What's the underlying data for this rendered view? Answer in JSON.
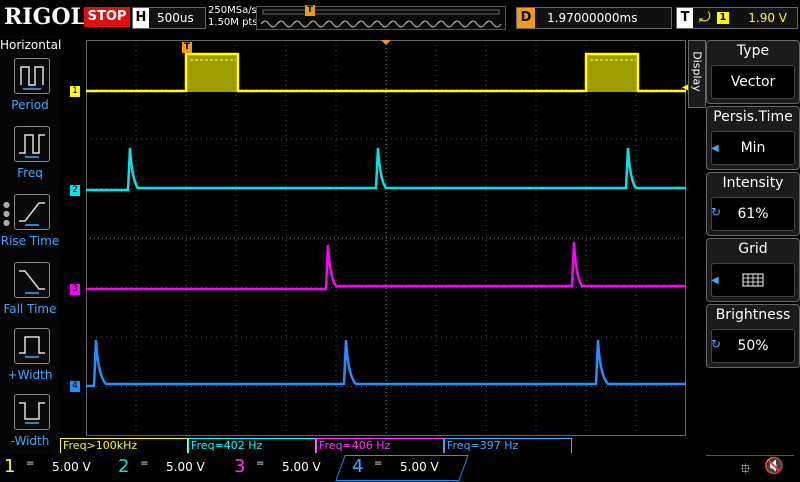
{
  "header": {
    "logo": "RIGOL",
    "run_state": "STOP",
    "timebase_label": "H",
    "timebase_value": "500us",
    "sample_rate": "250MSa/s",
    "memory_depth": "1.50M pts",
    "trigger_marker": "T",
    "delay_label": "D",
    "delay_value": "1.97000000ms",
    "trigger_label": "T",
    "trigger_source": "1",
    "trigger_level": "1.90 V"
  },
  "left_panel": {
    "title": "Horizontal",
    "items": [
      {
        "label": "Period",
        "icon": "period-icon"
      },
      {
        "label": "Freq",
        "icon": "freq-icon"
      },
      {
        "label": "Rise Time",
        "icon": "rise-time-icon"
      },
      {
        "label": "Fall Time",
        "icon": "fall-time-icon"
      },
      {
        "label": "+Width",
        "icon": "pos-width-icon"
      },
      {
        "label": "-Width",
        "icon": "neg-width-icon"
      }
    ]
  },
  "right_panel": {
    "side_label": "Display",
    "cards": [
      {
        "title": "Type",
        "value": "Vector"
      },
      {
        "title": "Persis.Time",
        "value": "Min"
      },
      {
        "title": "Intensity",
        "value": "61%"
      },
      {
        "title": "Grid",
        "value": ""
      },
      {
        "title": "Brightness",
        "value": "50%"
      }
    ]
  },
  "measurements": [
    {
      "text": "Freq>100kHz",
      "color": "#ffff00"
    },
    {
      "text": "Freq=402 Hz",
      "color": "#00ffff"
    },
    {
      "text": "Freq=406 Hz",
      "color": "#ff33ff"
    },
    {
      "text": "Freq=397 Hz",
      "color": "#3fa9ff"
    }
  ],
  "channels": [
    {
      "num": "1",
      "scale": "5.00 V",
      "color": "#ffff00"
    },
    {
      "num": "2",
      "scale": "5.00 V",
      "color": "#00e5e5"
    },
    {
      "num": "3",
      "scale": "5.00 V",
      "color": "#ff33ff"
    },
    {
      "num": "4",
      "scale": "5.00 V",
      "color": "#3fa9ff"
    }
  ],
  "colors": {
    "ch1": "#ffff00",
    "ch2": "#00e5e5",
    "ch3": "#ff00ff",
    "ch4": "#1e90ff",
    "stop": "#dd1111",
    "delay": "#f39c12",
    "accent": "#3fa9ff"
  },
  "icons": {
    "usb": "usb-icon",
    "sound": "mute-icon"
  }
}
